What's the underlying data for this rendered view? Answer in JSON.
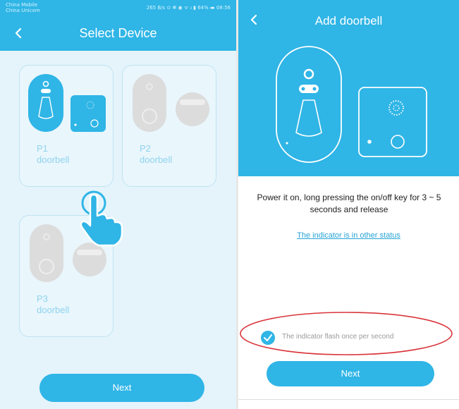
{
  "status_bar": {
    "carrier_line1": "China Mobile",
    "carrier_line2": "China Unicom",
    "right_text": "265 B/s ⊙ ✻ ◉ ᯤ ᵢₗ ▮ 64% ▬ 08:56"
  },
  "select_device": {
    "title": "Select Device",
    "devices": [
      {
        "model": "P1",
        "type": "doorbell",
        "selected": true
      },
      {
        "model": "P2",
        "type": "doorbell",
        "selected": false
      },
      {
        "model": "P3",
        "type": "doorbell",
        "selected": false
      }
    ],
    "next_label": "Next"
  },
  "add_doorbell": {
    "title": "Add doorbell",
    "instruction": "Power it on, long pressing the on/off key for 3 ~ 5 seconds and release",
    "status_link": "The indicator is in other status",
    "confirm_label": "The indicator flash once per second",
    "confirm_checked": true,
    "next_label": "Next"
  },
  "colors": {
    "accent": "#2fb5e6",
    "card_background": "#e9f6fc",
    "annotation": "#d9343a"
  },
  "icons": [
    "back-arrow-icon",
    "doorbell-icon",
    "chime-icon",
    "pointing-hand-icon",
    "check-icon"
  ]
}
